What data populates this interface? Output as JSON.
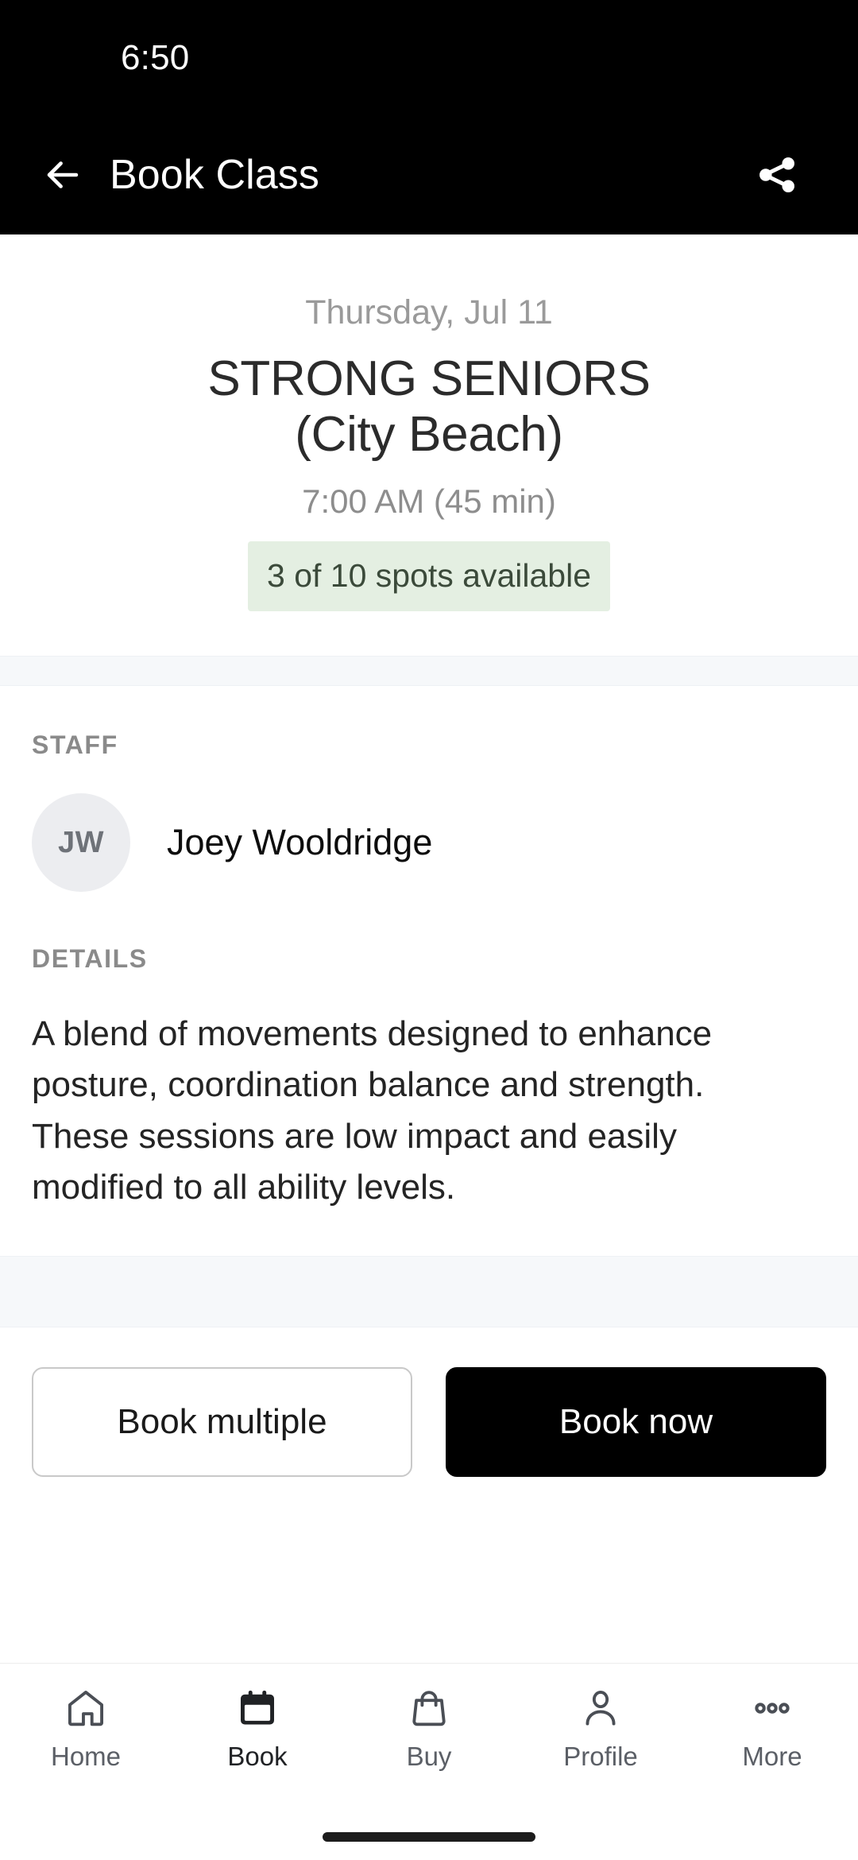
{
  "status_bar": {
    "time": "6:50"
  },
  "app_bar": {
    "title": "Book Class",
    "back_icon": "arrow-left-icon",
    "share_icon": "share-icon"
  },
  "class": {
    "date": "Thursday, Jul 11",
    "title_line1": "STRONG SENIORS",
    "title_line2": "(City Beach)",
    "time": "7:00 AM (45 min)",
    "spots_badge": "3 of 10 spots available",
    "spots_badge_bg": "#e4efe2",
    "spots_badge_color": "#3b4a3a"
  },
  "staff_section": {
    "label": "STAFF",
    "avatar_initials": "JW",
    "name": "Joey Wooldridge"
  },
  "details_section": {
    "label": "DETAILS",
    "text": "A blend of movements designed to enhance posture, coordination balance and strength. These sessions are low impact and easily modified to all ability levels."
  },
  "actions": {
    "secondary_label": "Book multiple",
    "primary_label": "Book now",
    "primary_bg": "#000000",
    "primary_color": "#ffffff"
  },
  "bottom_nav": {
    "items": [
      {
        "label": "Home",
        "icon": "home-icon",
        "active": false
      },
      {
        "label": "Book",
        "icon": "calendar-icon",
        "active": true
      },
      {
        "label": "Buy",
        "icon": "bag-icon",
        "active": false
      },
      {
        "label": "Profile",
        "icon": "person-icon",
        "active": false
      },
      {
        "label": "More",
        "icon": "ellipsis-icon",
        "active": false
      }
    ]
  }
}
